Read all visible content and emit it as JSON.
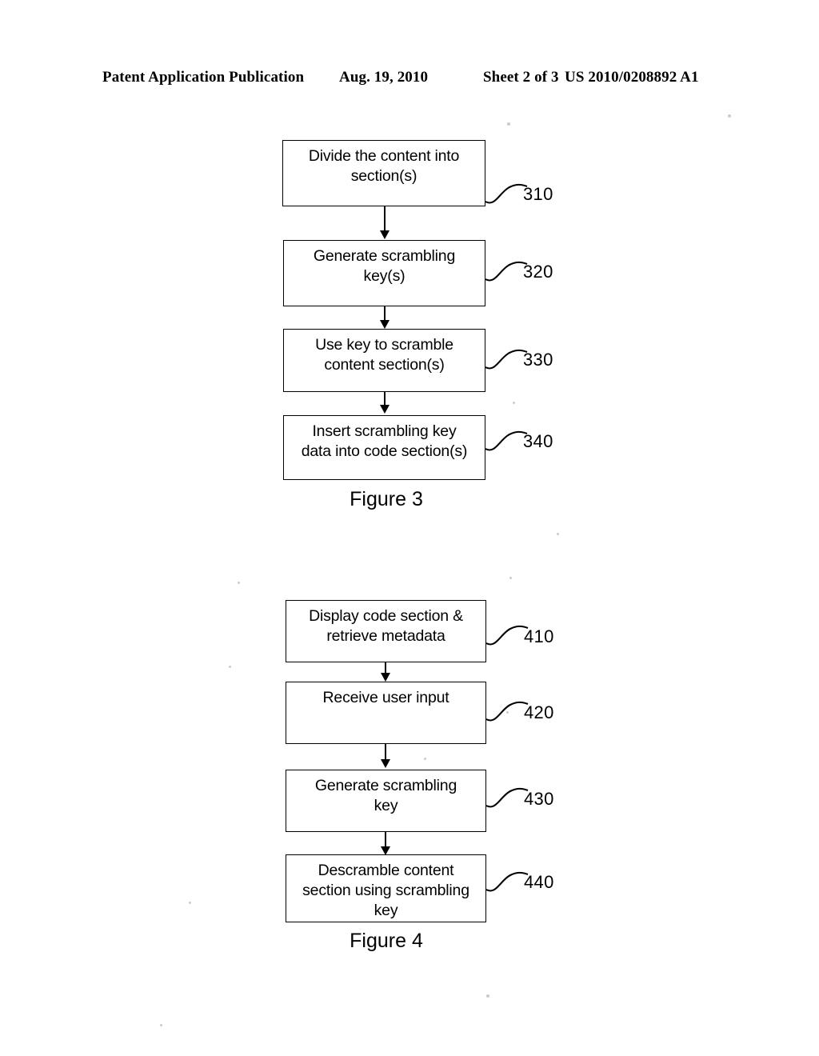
{
  "header": {
    "publication": "Patent Application Publication",
    "date": "Aug. 19, 2010",
    "sheet": "Sheet 2 of 3",
    "patent_number": "US 2010/0208892 A1"
  },
  "figures": [
    {
      "id": "figure-3",
      "caption": "Figure 3",
      "steps": [
        {
          "ref": "310",
          "lines": [
            "Divide the content into",
            "section(s)"
          ]
        },
        {
          "ref": "320",
          "lines": [
            "Generate scrambling",
            "key(s)"
          ]
        },
        {
          "ref": "330",
          "lines": [
            "Use key to scramble",
            "content section(s)"
          ]
        },
        {
          "ref": "340",
          "lines": [
            "Insert scrambling key",
            "data into code section(s)"
          ]
        }
      ]
    },
    {
      "id": "figure-4",
      "caption": "Figure 4",
      "steps": [
        {
          "ref": "410",
          "lines": [
            "Display code section &",
            "retrieve metadata"
          ]
        },
        {
          "ref": "420",
          "lines": [
            "Receive user input"
          ]
        },
        {
          "ref": "430",
          "lines": [
            "Generate scrambling",
            "key"
          ]
        },
        {
          "ref": "440",
          "lines": [
            "Descramble content",
            "section using scrambling",
            "key"
          ]
        }
      ]
    }
  ],
  "colors": {
    "ink": "#000000",
    "page": "#ffffff"
  }
}
